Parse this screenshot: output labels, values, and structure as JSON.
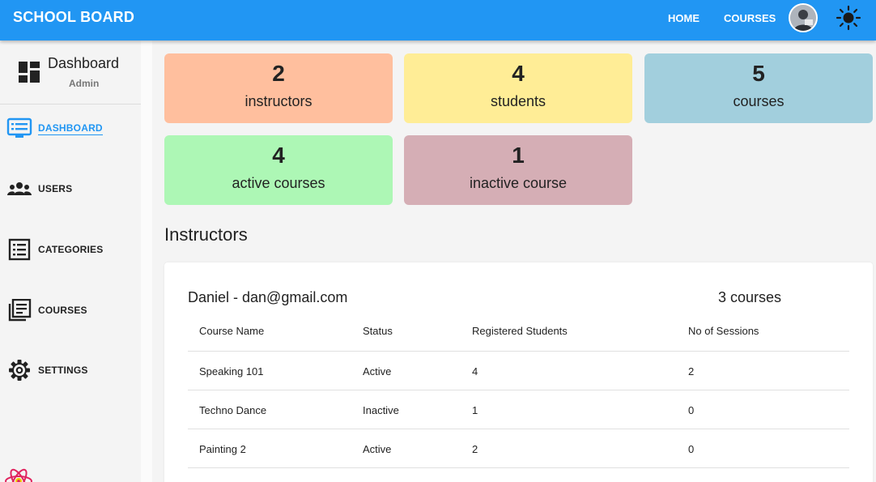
{
  "appbar": {
    "brand": "SCHOOL BOARD",
    "nav": {
      "home": "HOME",
      "courses": "COURSES"
    },
    "accent_color": "#2196f3"
  },
  "sidebar": {
    "title": "Dashboard",
    "role": "Admin",
    "items": [
      {
        "label": "DASHBOARD",
        "icon": "dashboard-list-icon",
        "active": true
      },
      {
        "label": "USERS",
        "icon": "users-icon",
        "active": false
      },
      {
        "label": "CATEGORIES",
        "icon": "categories-icon",
        "active": false
      },
      {
        "label": "COURSES",
        "icon": "courses-icon",
        "active": false
      },
      {
        "label": "SETTINGS",
        "icon": "gear-icon",
        "active": false
      }
    ]
  },
  "stats": [
    {
      "value": "2",
      "label": "instructors",
      "color": "#ffbf9e"
    },
    {
      "value": "4",
      "label": "students",
      "color": "#ffed96"
    },
    {
      "value": "5",
      "label": "courses",
      "color": "#a2cfdd"
    },
    {
      "value": "4",
      "label": "active courses",
      "color": "#adf7b5"
    },
    {
      "value": "1",
      "label": "inactive course",
      "color": "#d5aeb5"
    }
  ],
  "instructors_section": {
    "title": "Instructors",
    "instructor": {
      "name": "Daniel - dan@gmail.com",
      "courses_count": "3 courses",
      "columns": [
        "Course Name",
        "Status",
        "Registered Students",
        "No of Sessions"
      ],
      "rows": [
        [
          "Speaking 101",
          "Active",
          "4",
          "2"
        ],
        [
          "Techno Dance",
          "Inactive",
          "1",
          "0"
        ],
        [
          "Painting 2",
          "Active",
          "2",
          "0"
        ]
      ]
    }
  }
}
